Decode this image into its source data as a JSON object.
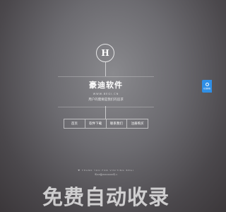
{
  "logo": {
    "letter": "H"
  },
  "hero": {
    "title": "豪迪软件",
    "url": "WWW.BEGI.CN",
    "tagline": "用户的需要是我们的追求"
  },
  "nav": {
    "items": [
      {
        "label": "首页"
      },
      {
        "label": "软件下载"
      },
      {
        "label": "联系我们"
      },
      {
        "label": "注册购买"
      }
    ]
  },
  "footer": {
    "thanks": "♥ THANK YOU FOR VISITING BEGI",
    "icp": "粤ICP备09104400号-1"
  },
  "float_button": {
    "label": "在线客服",
    "icon": "chat-icon",
    "color": "#2f8fe6"
  },
  "watermark": {
    "text": "免费自动收录"
  }
}
